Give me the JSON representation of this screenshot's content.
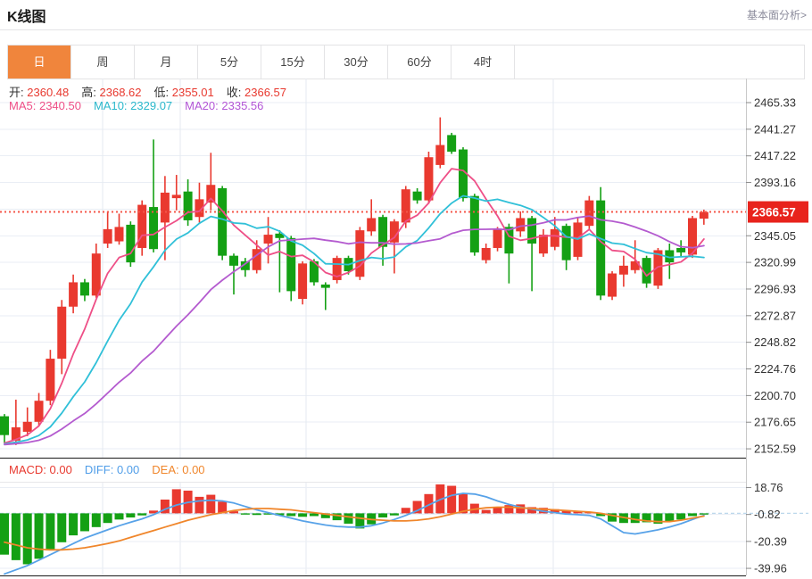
{
  "header": {
    "title": "K线图",
    "link_label": "基本面分析>"
  },
  "tabs": [
    {
      "label": "日",
      "active": true
    },
    {
      "label": "周",
      "active": false
    },
    {
      "label": "月",
      "active": false
    },
    {
      "label": "5分",
      "active": false
    },
    {
      "label": "15分",
      "active": false
    },
    {
      "label": "30分",
      "active": false
    },
    {
      "label": "60分",
      "active": false
    },
    {
      "label": "4时",
      "active": false
    }
  ],
  "quote_bar": {
    "open_label": "开:",
    "open_value": "2360.48",
    "high_label": "高:",
    "high_value": "2368.62",
    "low_label": "低:",
    "low_value": "2355.01",
    "close_label": "收:",
    "close_value": "2366.57"
  },
  "ma_bar": {
    "ma5_label": "MA5:",
    "ma5_value": "2340.50",
    "ma10_label": "MA10:",
    "ma10_value": "2329.07",
    "ma20_label": "MA20:",
    "ma20_value": "2335.56"
  },
  "macd_bar": {
    "macd_label": "MACD:",
    "macd_value": "0.00",
    "diff_label": "DIFF:",
    "diff_value": "0.00",
    "dea_label": "DEA:",
    "dea_value": "0.00"
  },
  "price_badge": {
    "value": "2366.57"
  },
  "colors": {
    "up": "#e9392f",
    "down": "#14a014",
    "ma5": "#ee4f87",
    "ma10": "#30c0d8",
    "ma20": "#b45bcf",
    "diff_line": "#57a2e8",
    "dea_line": "#f0862b",
    "badge": "#e8231c",
    "tab_active": "#f0853c",
    "dotted_line": "#f4574a",
    "grid": "#eaeef5",
    "vgrid": "#e4e9f0",
    "axis_text": "#333333",
    "tick": "#8a8a8a",
    "border": "#c9c9c9",
    "pane_divider": "#1a1a1a",
    "macd_zero_dash": "#bcd8ec"
  },
  "chart_data": {
    "type": "candlestick",
    "title": "K线图",
    "timeframe_selected": "日",
    "legend": [
      "MA5",
      "MA10",
      "MA20"
    ],
    "y_axis_main": {
      "labels": [
        "2465.33",
        "2441.27",
        "2417.22",
        "2393.16",
        "2345.05",
        "2320.99",
        "2296.93",
        "2272.87",
        "2248.82",
        "2224.76",
        "2200.70",
        "2176.65",
        "2152.59"
      ],
      "top_value": 2465.33,
      "step": 24.055,
      "gridline_count": 14
    },
    "current_price": 2366.57,
    "candles_ohlc": [
      [
        2182,
        2184,
        2158,
        2165
      ],
      [
        2160,
        2197,
        2156,
        2172
      ],
      [
        2168,
        2190,
        2164,
        2177
      ],
      [
        2177,
        2203,
        2173,
        2196
      ],
      [
        2196,
        2242,
        2192,
        2234
      ],
      [
        2234,
        2287,
        2220,
        2281
      ],
      [
        2281,
        2310,
        2275,
        2303
      ],
      [
        2303,
        2306,
        2286,
        2291
      ],
      [
        2291,
        2338,
        2289,
        2329
      ],
      [
        2338,
        2367,
        2334,
        2351
      ],
      [
        2340,
        2365,
        2337,
        2353
      ],
      [
        2355,
        2358,
        2317,
        2321
      ],
      [
        2334,
        2377,
        2327,
        2373
      ],
      [
        2371,
        2432,
        2330,
        2333
      ],
      [
        2357,
        2399,
        2323,
        2384
      ],
      [
        2379,
        2400,
        2368,
        2382
      ],
      [
        2385,
        2396,
        2354,
        2359
      ],
      [
        2362,
        2393,
        2357,
        2378
      ],
      [
        2375,
        2420,
        2368,
        2391
      ],
      [
        2388,
        2390,
        2323,
        2327
      ],
      [
        2327,
        2329,
        2292,
        2318
      ],
      [
        2322,
        2325,
        2308,
        2314
      ],
      [
        2314,
        2341,
        2311,
        2333
      ],
      [
        2338,
        2362,
        2320,
        2346
      ],
      [
        2347,
        2350,
        2294,
        2343
      ],
      [
        2343,
        2345,
        2286,
        2295
      ],
      [
        2288,
        2322,
        2283,
        2320
      ],
      [
        2322,
        2324,
        2300,
        2303
      ],
      [
        2301,
        2303,
        2278,
        2298
      ],
      [
        2305,
        2327,
        2302,
        2325
      ],
      [
        2325,
        2327,
        2310,
        2313
      ],
      [
        2308,
        2353,
        2305,
        2350
      ],
      [
        2349,
        2378,
        2345,
        2361
      ],
      [
        2362,
        2364,
        2318,
        2335
      ],
      [
        2339,
        2360,
        2311,
        2358
      ],
      [
        2357,
        2390,
        2352,
        2387
      ],
      [
        2385,
        2388,
        2374,
        2377
      ],
      [
        2377,
        2421,
        2374,
        2416
      ],
      [
        2409,
        2452,
        2406,
        2427
      ],
      [
        2436,
        2438,
        2419,
        2421
      ],
      [
        2423,
        2425,
        2376,
        2379
      ],
      [
        2381,
        2383,
        2327,
        2330
      ],
      [
        2323,
        2338,
        2320,
        2334
      ],
      [
        2334,
        2353,
        2331,
        2351
      ],
      [
        2353,
        2356,
        2302,
        2329
      ],
      [
        2349,
        2367,
        2344,
        2361
      ],
      [
        2361,
        2363,
        2295,
        2338
      ],
      [
        2329,
        2351,
        2326,
        2346
      ],
      [
        2335,
        2362,
        2332,
        2351
      ],
      [
        2354,
        2356,
        2314,
        2323
      ],
      [
        2326,
        2361,
        2323,
        2357
      ],
      [
        2354,
        2381,
        2350,
        2377
      ],
      [
        2377,
        2389,
        2287,
        2291
      ],
      [
        2290,
        2313,
        2287,
        2311
      ],
      [
        2310,
        2327,
        2299,
        2318
      ],
      [
        2314,
        2341,
        2311,
        2322
      ],
      [
        2325,
        2327,
        2298,
        2302
      ],
      [
        2300,
        2334,
        2297,
        2332
      ],
      [
        2332,
        2338,
        2306,
        2321
      ],
      [
        2334,
        2341,
        2326,
        2330
      ],
      [
        2328,
        2363,
        2325,
        2361
      ],
      [
        2360.48,
        2368.62,
        2355.01,
        2366.57
      ]
    ],
    "ma_periods": [
      5,
      10,
      20
    ],
    "macd": {
      "y_axis_labels": [
        "18.76",
        "-0.82",
        "-20.39",
        "-39.96"
      ],
      "bar": [
        -30,
        -34,
        -37,
        -33,
        -27,
        -21,
        -16,
        -13,
        -10,
        -7,
        -4.5,
        -3,
        -1.5,
        2,
        10,
        17.5,
        16.5,
        12,
        13.5,
        8.5,
        1.5,
        -0.8,
        -1.2,
        -0.8,
        -1.5,
        -2,
        -2.5,
        -2,
        -3.5,
        -5,
        -7.5,
        -11,
        -8,
        -3,
        -1.5,
        4,
        9,
        14,
        21,
        20,
        14,
        7,
        2.5,
        4.5,
        6,
        6.5,
        4.5,
        4,
        3,
        2,
        1.2,
        0.5,
        -2,
        -6,
        -7,
        -7,
        -6.5,
        -7.5,
        -6,
        -4.5,
        -2,
        -0.5
      ],
      "diff": [
        -44,
        -41,
        -38,
        -34,
        -30,
        -26,
        -22,
        -18,
        -15,
        -12,
        -9,
        -6.5,
        -4,
        -1,
        3,
        6,
        8,
        9,
        9.5,
        9,
        7.5,
        5,
        2.5,
        0.5,
        -1.5,
        -3.5,
        -5.5,
        -7,
        -8.5,
        -9.5,
        -10,
        -10,
        -9,
        -7,
        -4.5,
        -1.5,
        2,
        6,
        10,
        13,
        14.5,
        14,
        12,
        9,
        6.5,
        4.5,
        3,
        1.5,
        0.5,
        -0.5,
        -1,
        -1.5,
        -4,
        -9,
        -14,
        -15,
        -13.5,
        -12,
        -10,
        -7.5,
        -4.5,
        -1.5
      ],
      "dea": [
        -21,
        -23,
        -25,
        -26,
        -26.5,
        -26.5,
        -26,
        -25,
        -23.5,
        -22,
        -20,
        -17.5,
        -15,
        -12.5,
        -10,
        -7.5,
        -5,
        -3,
        -1,
        0.5,
        2,
        3,
        3.5,
        3.5,
        3,
        2.5,
        1.5,
        0.5,
        -0.5,
        -1.5,
        -2.5,
        -3.5,
        -4.5,
        -5,
        -5.5,
        -5.5,
        -5,
        -4,
        -2.5,
        -0.5,
        1.5,
        3,
        4,
        4.5,
        4.5,
        4,
        3.5,
        3,
        2.5,
        2,
        1.5,
        1,
        0,
        -1.5,
        -3,
        -4.5,
        -5.5,
        -6,
        -6,
        -5,
        -3.5,
        -2
      ]
    }
  }
}
